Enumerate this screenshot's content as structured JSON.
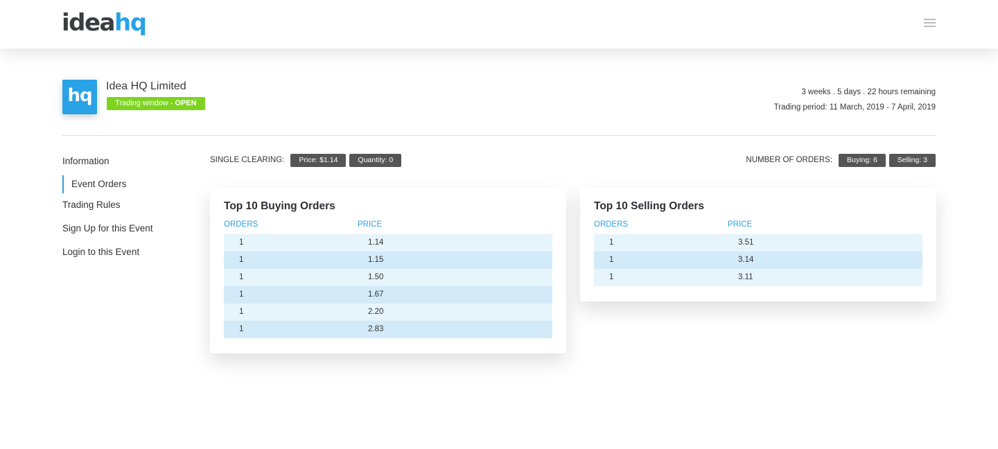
{
  "header": {
    "logo": {
      "part1": "idea",
      "part2": "hq"
    },
    "menu_icon": "hamburger-menu-icon"
  },
  "company": {
    "logo_text": "hq",
    "name": "Idea HQ Limited",
    "status_prefix": "Trading window - ",
    "status_value": "OPEN",
    "remaining": "3 weeks . 5 days . 22 hours remaining",
    "period": "Trading period: 11 March, 2019 - 7 April, 2019"
  },
  "colors": {
    "accent": "#29a3e6",
    "status_open": "#7ed321",
    "chip": "#555555"
  },
  "sidebar": {
    "items": [
      {
        "label": "Information"
      },
      {
        "label": "Event Orders",
        "active": true
      },
      {
        "label": "Trading Rules"
      },
      {
        "label": "Sign Up for this Event"
      },
      {
        "label": "Login to this Event"
      }
    ]
  },
  "summary": {
    "clearing_label": "SINGLE CLEARING:",
    "price_chip": "Price: $1.14",
    "quantity_chip": "Quantity: 0",
    "orders_label": "NUMBER OF ORDERS:",
    "buying_chip": "Buying: 6",
    "selling_chip": "Selling: 3"
  },
  "buying": {
    "title": "Top 10 Buying Orders",
    "columns": [
      "ORDERS",
      "PRICE"
    ],
    "rows": [
      {
        "orders": "1",
        "price": "1.14"
      },
      {
        "orders": "1",
        "price": "1.15"
      },
      {
        "orders": "1",
        "price": "1.50"
      },
      {
        "orders": "1",
        "price": "1.67"
      },
      {
        "orders": "1",
        "price": "2.20"
      },
      {
        "orders": "1",
        "price": "2.83"
      }
    ]
  },
  "selling": {
    "title": "Top 10 Selling Orders",
    "columns": [
      "ORDERS",
      "PRICE"
    ],
    "rows": [
      {
        "orders": "1",
        "price": "3.51"
      },
      {
        "orders": "1",
        "price": "3.14"
      },
      {
        "orders": "1",
        "price": "3.11"
      }
    ]
  }
}
